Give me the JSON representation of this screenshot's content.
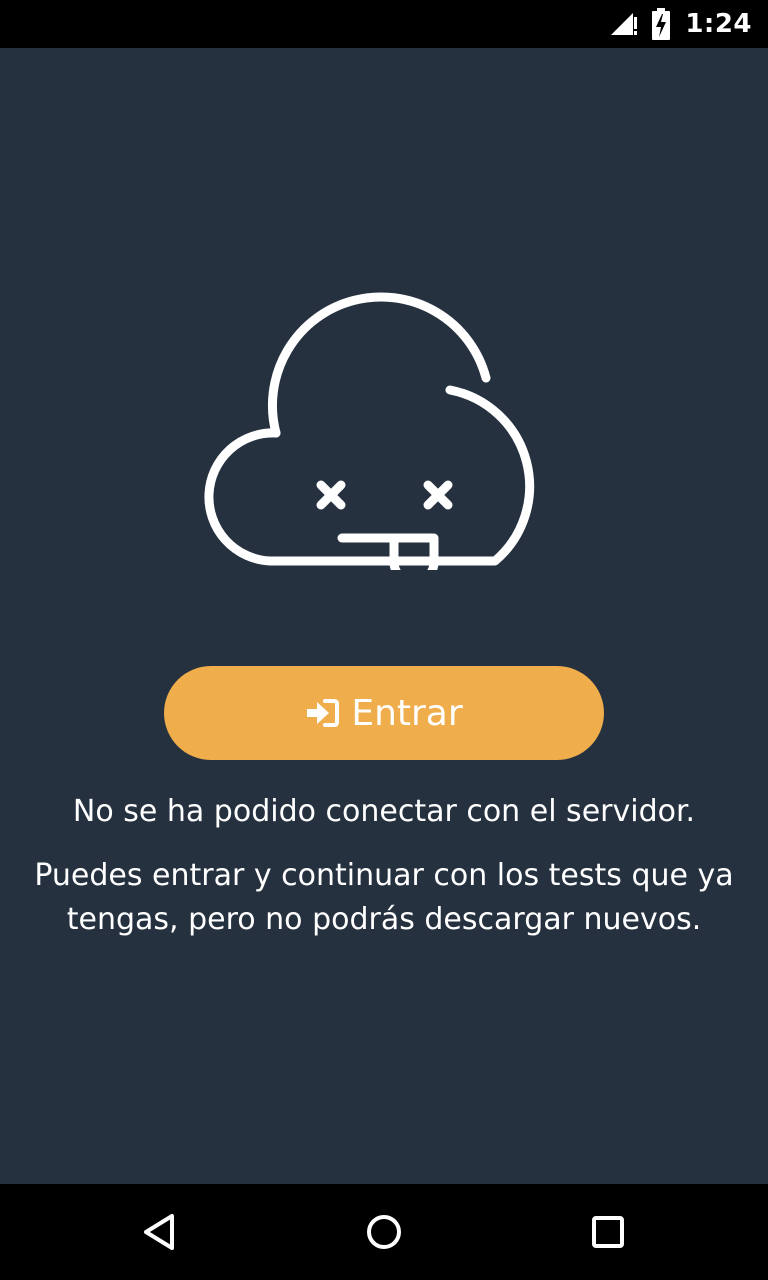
{
  "status_bar": {
    "time": "1:24",
    "icons": [
      "signal-icon",
      "battery-charging-icon"
    ]
  },
  "illustration": {
    "icon": "sad-cloud-icon",
    "stroke_color": "#FFFFFF"
  },
  "enter_button": {
    "label": "Entrar",
    "icon": "sign-in-icon",
    "color": "#EFAD4C"
  },
  "messages": {
    "primary": "No se ha podido conectar con el servidor.",
    "secondary": "Puedes entrar y continuar con los tests que ya tengas, pero no podrás descargar nuevos."
  },
  "navigation": {
    "items": [
      "back-icon",
      "home-icon",
      "recents-icon"
    ]
  },
  "colors": {
    "background": "#263140",
    "accent": "#EFAD4C",
    "text": "#FFFFFF"
  }
}
